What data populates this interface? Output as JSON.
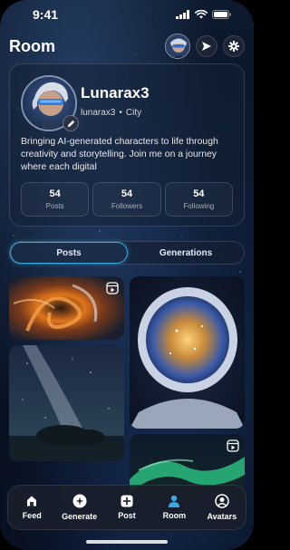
{
  "status_bar": {
    "time": "9:41"
  },
  "header": {
    "title": "Room"
  },
  "profile": {
    "name": "Lunarax3",
    "handle": "lunarax3",
    "separator": "•",
    "location": "City",
    "bio": "Bringing AI-generated characters to life through creativity and storytelling. Join me on a journey where each digital",
    "stats": [
      {
        "value": "54",
        "label": "Posts"
      },
      {
        "value": "54",
        "label": "Followers"
      },
      {
        "value": "54",
        "label": "Following"
      }
    ]
  },
  "tabs": [
    {
      "label": "Posts",
      "active": true
    },
    {
      "label": "Generations",
      "active": false
    }
  ],
  "nav": [
    {
      "label": "Feed",
      "icon": "feed-icon"
    },
    {
      "label": "Generate",
      "icon": "generate-icon"
    },
    {
      "label": "Post",
      "icon": "plus-square-icon"
    },
    {
      "label": "Room",
      "icon": "person-icon",
      "active": true
    },
    {
      "label": "Avatars",
      "icon": "avatar-circle-icon"
    }
  ],
  "colors": {
    "accent": "#3aa9e0",
    "room_icon": "#3aa9e0"
  }
}
